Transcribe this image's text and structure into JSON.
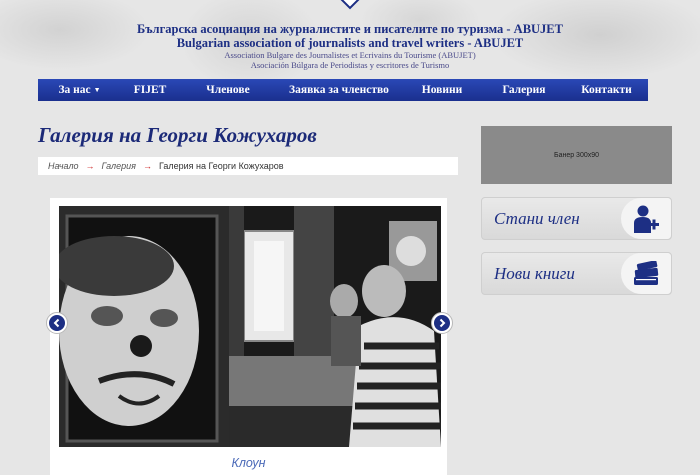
{
  "header": {
    "title_bg": "Българска асоциация на журналистите и писателите по туризма - ABUJET",
    "title_en": "Bulgarian association of journalists and travel writers - ABUJET",
    "title_fr": "Association Bulgare des Journalistes et Ecrivains du Tourisme (ABUJET)",
    "title_es": "Asociación Búlgara de Periodistas y escritores de Turismo"
  },
  "nav": {
    "items": [
      {
        "label": "За нас",
        "caret": "▼"
      },
      {
        "label": "FIJET"
      },
      {
        "label": "Членове"
      },
      {
        "label": "Заявка за членство"
      },
      {
        "label": "Новини"
      },
      {
        "label": "Галерия"
      },
      {
        "label": "Контакти"
      }
    ]
  },
  "page": {
    "title": "Галерия на Георги Кожухаров"
  },
  "breadcrumb": {
    "items": [
      "Начало",
      "Галерия"
    ],
    "current": "Галерия на Георги Кожухаров",
    "separator": "→"
  },
  "gallery": {
    "caption": "Клоун",
    "prev_icon": "chevron-left-icon",
    "next_icon": "chevron-right-icon"
  },
  "sidebar": {
    "banner_text": "Банер 300x90",
    "buttons": [
      {
        "label": "Стани член",
        "icon": "add-user-icon"
      },
      {
        "label": "Нови книги",
        "icon": "books-icon"
      }
    ]
  },
  "colors": {
    "brand_blue": "#1d2f84",
    "nav_blue": "#2a48b6",
    "breadcrumb_arrow": "#cc2222",
    "caption": "#4b6ab8"
  }
}
